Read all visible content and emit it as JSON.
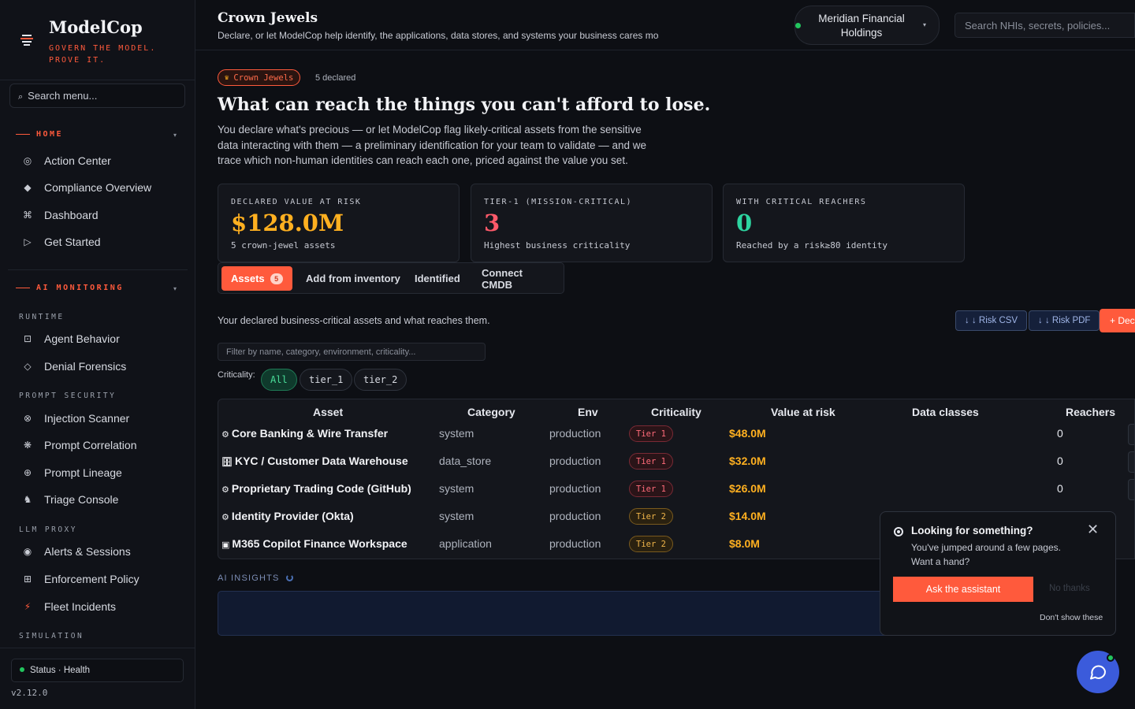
{
  "brand": {
    "name": "ModelCop",
    "tagline": "GOVERN THE MODEL. PROVE IT.",
    "icon": "layers-icon"
  },
  "sidebar": {
    "search_placeholder": "Search menu...",
    "sections": [
      {
        "title": "HOME",
        "items": [
          {
            "label": "Action Center",
            "icon": "target-icon"
          },
          {
            "label": "Compliance Overview",
            "icon": "diamond-icon"
          },
          {
            "label": "Dashboard",
            "icon": "command-icon"
          },
          {
            "label": "Get Started",
            "icon": "play-icon"
          }
        ]
      },
      {
        "title": "AI MONITORING",
        "groups": [
          {
            "title": "RUNTIME",
            "items": [
              {
                "label": "Agent Behavior",
                "icon": "square-dot-icon"
              },
              {
                "label": "Denial Forensics",
                "icon": "diamond-outline-icon"
              }
            ]
          },
          {
            "title": "PROMPT SECURITY",
            "items": [
              {
                "label": "Injection Scanner",
                "icon": "x-circle-icon"
              },
              {
                "label": "Prompt Correlation",
                "icon": "atom-icon"
              },
              {
                "label": "Prompt Lineage",
                "icon": "globe-icon"
              },
              {
                "label": "Triage Console",
                "icon": "users-icon"
              }
            ]
          },
          {
            "title": "LLM PROXY",
            "items": [
              {
                "label": "Alerts & Sessions",
                "icon": "radio-icon"
              },
              {
                "label": "Enforcement Policy",
                "icon": "grid-icon"
              },
              {
                "label": "Fleet Incidents",
                "icon": "bolt-icon"
              }
            ]
          },
          {
            "title": "SIMULATION",
            "items": []
          }
        ]
      }
    ],
    "status": "Status · Health",
    "version": "v2.12.0"
  },
  "header": {
    "title": "Crown Jewels",
    "subtitle": "Declare, or let ModelCop help identify, the applications, data stores, and systems your business cares mos",
    "org": "Meridian Financial Holdings",
    "search_placeholder": "Search NHIs, secrets, policies..."
  },
  "hero": {
    "pill": "Crown Jewels",
    "declared": "5 declared",
    "title": "What can reach the things you can't afford to lose.",
    "desc": "You declare what's precious — or let ModelCop flag likely-critical assets from the sensitive data interacting with them — a preliminary identification for your team to validate — and we trace which non-human identities can reach each one, priced against the value you set."
  },
  "stats": [
    {
      "label": "DECLARED VALUE AT RISK",
      "value": "$128.0M",
      "note": "5 crown-jewel assets",
      "color": "#ffb020"
    },
    {
      "label": "TIER-1 (MISSION-CRITICAL)",
      "value": "3",
      "note": "Highest business criticality",
      "color": "#ff5a6a"
    },
    {
      "label": "WITH CRITICAL REACHERS",
      "value": "0",
      "note": "Reached by a risk≥80 identity",
      "color": "#2dd4a0"
    }
  ],
  "tabs": [
    {
      "label": "Assets",
      "badge": "5"
    },
    {
      "label": "Add from inventory"
    },
    {
      "label": "Identified"
    },
    {
      "label": "Connect CMDB"
    }
  ],
  "list": {
    "desc": "Your declared business-critical assets and what reaches them.",
    "csv": "↓ ↓ Risk CSV",
    "pdf": "↓ ↓ Risk PDF",
    "declare": "+ Dec",
    "filter_placeholder": "Filter by name, category, environment, criticality...",
    "criticality_label": "Criticality:",
    "chips": [
      "All",
      "tier_1",
      "tier_2"
    ]
  },
  "table": {
    "headers": [
      "Asset",
      "Category",
      "Env",
      "Criticality",
      "Value at risk",
      "Data classes",
      "Reachers"
    ],
    "rows": [
      {
        "icon": "⚙",
        "asset": "Core Banking & Wire Transfer",
        "category": "system",
        "env": "production",
        "tier": "Tier 1",
        "tier_level": 1,
        "value": "$48.0M",
        "reachers": "0"
      },
      {
        "icon": "🗄",
        "asset": "KYC / Customer Data Warehouse",
        "category": "data_store",
        "env": "production",
        "tier": "Tier 1",
        "tier_level": 1,
        "value": "$32.0M",
        "reachers": "0"
      },
      {
        "icon": "⚙",
        "asset": "Proprietary Trading Code (GitHub)",
        "category": "system",
        "env": "production",
        "tier": "Tier 1",
        "tier_level": 1,
        "value": "$26.0M",
        "reachers": "0"
      },
      {
        "icon": "⚙",
        "asset": "Identity Provider (Okta)",
        "category": "system",
        "env": "production",
        "tier": "Tier 2",
        "tier_level": 2,
        "value": "$14.0M",
        "reachers": ""
      },
      {
        "icon": "▣",
        "asset": "M365 Copilot Finance Workspace",
        "category": "application",
        "env": "production",
        "tier": "Tier 2",
        "tier_level": 2,
        "value": "$8.0M",
        "reachers": ""
      }
    ]
  },
  "ai": {
    "title": "AI INSIGHTS"
  },
  "popup": {
    "title": "Looking for something?",
    "body": "You've jumped around a few pages. Want a hand?",
    "primary": "Ask the assistant",
    "secondary": "No thanks",
    "dismiss": "Don't show these"
  }
}
